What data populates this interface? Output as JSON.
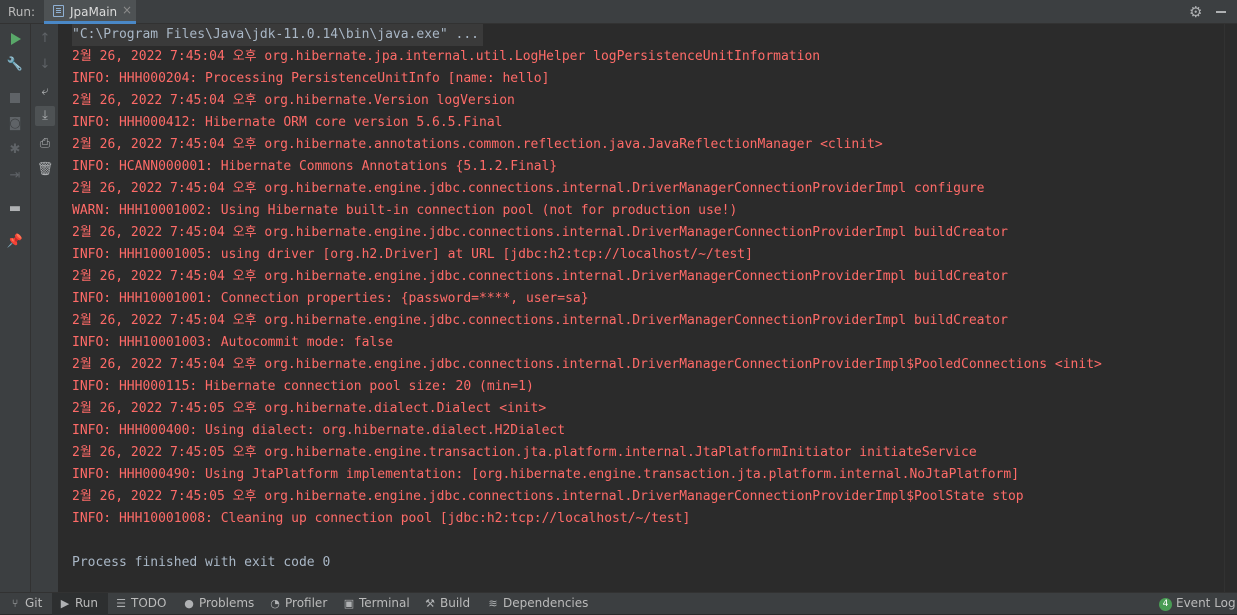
{
  "header": {
    "run_label": "Run:",
    "tab_label": "JpaMain",
    "tab_close": "×"
  },
  "console": {
    "lines": [
      {
        "text": "\"C:\\Program Files\\Java\\jdk-11.0.14\\bin\\java.exe\" ...",
        "kind": "cmd"
      },
      {
        "text": "2월 26, 2022 7:45:04 오후 org.hibernate.jpa.internal.util.LogHelper logPersistenceUnitInformation",
        "kind": "err"
      },
      {
        "text": "INFO: HHH000204: Processing PersistenceUnitInfo [name: hello]",
        "kind": "err"
      },
      {
        "text": "2월 26, 2022 7:45:04 오후 org.hibernate.Version logVersion",
        "kind": "err"
      },
      {
        "text": "INFO: HHH000412: Hibernate ORM core version 5.6.5.Final",
        "kind": "err"
      },
      {
        "text": "2월 26, 2022 7:45:04 오후 org.hibernate.annotations.common.reflection.java.JavaReflectionManager <clinit>",
        "kind": "err"
      },
      {
        "text": "INFO: HCANN000001: Hibernate Commons Annotations {5.1.2.Final}",
        "kind": "err"
      },
      {
        "text": "2월 26, 2022 7:45:04 오후 org.hibernate.engine.jdbc.connections.internal.DriverManagerConnectionProviderImpl configure",
        "kind": "err"
      },
      {
        "text": "WARN: HHH10001002: Using Hibernate built-in connection pool (not for production use!)",
        "kind": "err"
      },
      {
        "text": "2월 26, 2022 7:45:04 오후 org.hibernate.engine.jdbc.connections.internal.DriverManagerConnectionProviderImpl buildCreator",
        "kind": "err"
      },
      {
        "text": "INFO: HHH10001005: using driver [org.h2.Driver] at URL [jdbc:h2:tcp://localhost/~/test]",
        "kind": "err"
      },
      {
        "text": "2월 26, 2022 7:45:04 오후 org.hibernate.engine.jdbc.connections.internal.DriverManagerConnectionProviderImpl buildCreator",
        "kind": "err"
      },
      {
        "text": "INFO: HHH10001001: Connection properties: {password=****, user=sa}",
        "kind": "err"
      },
      {
        "text": "2월 26, 2022 7:45:04 오후 org.hibernate.engine.jdbc.connections.internal.DriverManagerConnectionProviderImpl buildCreator",
        "kind": "err"
      },
      {
        "text": "INFO: HHH10001003: Autocommit mode: false",
        "kind": "err"
      },
      {
        "text": "2월 26, 2022 7:45:04 오후 org.hibernate.engine.jdbc.connections.internal.DriverManagerConnectionProviderImpl$PooledConnections <init>",
        "kind": "err"
      },
      {
        "text": "INFO: HHH000115: Hibernate connection pool size: 20 (min=1)",
        "kind": "err"
      },
      {
        "text": "2월 26, 2022 7:45:05 오후 org.hibernate.dialect.Dialect <init>",
        "kind": "err"
      },
      {
        "text": "INFO: HHH000400: Using dialect: org.hibernate.dialect.H2Dialect",
        "kind": "err"
      },
      {
        "text": "2월 26, 2022 7:45:05 오후 org.hibernate.engine.transaction.jta.platform.internal.JtaPlatformInitiator initiateService",
        "kind": "err"
      },
      {
        "text": "INFO: HHH000490: Using JtaPlatform implementation: [org.hibernate.engine.transaction.jta.platform.internal.NoJtaPlatform]",
        "kind": "err"
      },
      {
        "text": "2월 26, 2022 7:45:05 오후 org.hibernate.engine.jdbc.connections.internal.DriverManagerConnectionProviderImpl$PoolState stop",
        "kind": "err"
      },
      {
        "text": "INFO: HHH10001008: Cleaning up connection pool [jdbc:h2:tcp://localhost/~/test]",
        "kind": "err"
      },
      {
        "text": "",
        "kind": "plain"
      },
      {
        "text": "Process finished with exit code 0",
        "kind": "plain"
      }
    ]
  },
  "statusbar": {
    "git": "Git",
    "run": "Run",
    "todo": "TODO",
    "problems": "Problems",
    "profiler": "Profiler",
    "terminal": "Terminal",
    "build": "Build",
    "dependencies": "Dependencies",
    "event_log": "Event Log",
    "event_count": "4"
  },
  "colors": {
    "error_text": "#ff6b68",
    "normal_text": "#a9b7c6",
    "background": "#2b2b2b"
  }
}
